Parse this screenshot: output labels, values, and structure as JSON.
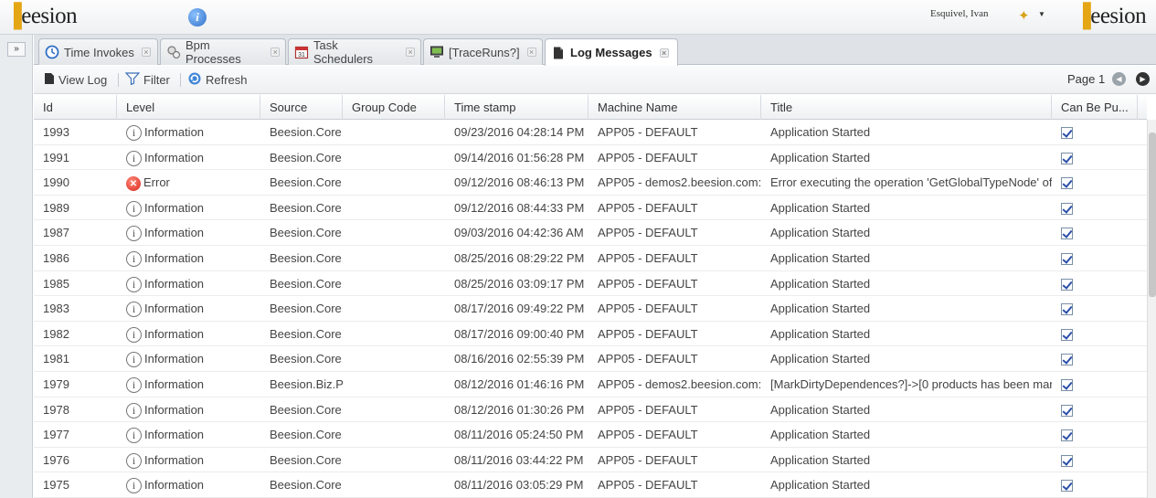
{
  "header": {
    "logo_left": "eesion",
    "logo_right": "eesion",
    "user_name": "Esquivel, Ivan",
    "info_icon_glyph": "i"
  },
  "leftstrip": {
    "expand_glyph": "»"
  },
  "tabs": [
    {
      "label": "Time Invokes",
      "icon": "clock-icon",
      "active": false
    },
    {
      "label": "Bpm Processes",
      "icon": "gears-icon",
      "active": false
    },
    {
      "label": "Task Schedulers",
      "icon": "calendar-icon",
      "active": false
    },
    {
      "label": "[TraceRuns?]",
      "icon": "monitor-icon",
      "active": false
    },
    {
      "label": "Log Messages",
      "icon": "document-icon",
      "active": true
    }
  ],
  "toolbar": {
    "view_log": "View Log",
    "filter": "Filter",
    "refresh": "Refresh",
    "page_label": "Page 1"
  },
  "grid": {
    "columns": [
      "Id",
      "Level",
      "Source",
      "Group Code",
      "Time stamp",
      "Machine Name",
      "Title",
      "Can Be Pu..."
    ],
    "rows": [
      {
        "id": "1993",
        "level": "Information",
        "source": "Beesion.Core.",
        "group": "",
        "time": "09/23/2016 04:28:14 PM",
        "machine": "APP05 - DEFAULT",
        "title": "Application Started",
        "can_be": true
      },
      {
        "id": "1991",
        "level": "Information",
        "source": "Beesion.Core.",
        "group": "",
        "time": "09/14/2016 01:56:28 PM",
        "machine": "APP05 - DEFAULT",
        "title": "Application Started",
        "can_be": true
      },
      {
        "id": "1990",
        "level": "Error",
        "source": "Beesion.Core.",
        "group": "",
        "time": "09/12/2016 08:46:13 PM",
        "machine": "APP05 - demos2.beesion.com:",
        "title": "Error executing the operation 'GetGlobalTypeNode' of",
        "can_be": true
      },
      {
        "id": "1989",
        "level": "Information",
        "source": "Beesion.Core.",
        "group": "",
        "time": "09/12/2016 08:44:33 PM",
        "machine": "APP05 - DEFAULT",
        "title": "Application Started",
        "can_be": true
      },
      {
        "id": "1987",
        "level": "Information",
        "source": "Beesion.Core.",
        "group": "",
        "time": "09/03/2016 04:42:36 AM",
        "machine": "APP05 - DEFAULT",
        "title": "Application Started",
        "can_be": true
      },
      {
        "id": "1986",
        "level": "Information",
        "source": "Beesion.Core.",
        "group": "",
        "time": "08/25/2016 08:29:22 PM",
        "machine": "APP05 - DEFAULT",
        "title": "Application Started",
        "can_be": true
      },
      {
        "id": "1985",
        "level": "Information",
        "source": "Beesion.Core.",
        "group": "",
        "time": "08/25/2016 03:09:17 PM",
        "machine": "APP05 - DEFAULT",
        "title": "Application Started",
        "can_be": true
      },
      {
        "id": "1983",
        "level": "Information",
        "source": "Beesion.Core.",
        "group": "",
        "time": "08/17/2016 09:49:22 PM",
        "machine": "APP05 - DEFAULT",
        "title": "Application Started",
        "can_be": true
      },
      {
        "id": "1982",
        "level": "Information",
        "source": "Beesion.Core.",
        "group": "",
        "time": "08/17/2016 09:00:40 PM",
        "machine": "APP05 - DEFAULT",
        "title": "Application Started",
        "can_be": true
      },
      {
        "id": "1981",
        "level": "Information",
        "source": "Beesion.Core.",
        "group": "",
        "time": "08/16/2016 02:55:39 PM",
        "machine": "APP05 - DEFAULT",
        "title": "Application Started",
        "can_be": true
      },
      {
        "id": "1979",
        "level": "Information",
        "source": "Beesion.Biz.P",
        "group": "",
        "time": "08/12/2016 01:46:16 PM",
        "machine": "APP05 - demos2.beesion.com:",
        "title": "[MarkDirtyDependences?]->[0 products has been mar",
        "can_be": true
      },
      {
        "id": "1978",
        "level": "Information",
        "source": "Beesion.Core.",
        "group": "",
        "time": "08/12/2016 01:30:26 PM",
        "machine": "APP05 - DEFAULT",
        "title": "Application Started",
        "can_be": true
      },
      {
        "id": "1977",
        "level": "Information",
        "source": "Beesion.Core.",
        "group": "",
        "time": "08/11/2016 05:24:50 PM",
        "machine": "APP05 - DEFAULT",
        "title": "Application Started",
        "can_be": true
      },
      {
        "id": "1976",
        "level": "Information",
        "source": "Beesion.Core.",
        "group": "",
        "time": "08/11/2016 03:44:22 PM",
        "machine": "APP05 - DEFAULT",
        "title": "Application Started",
        "can_be": true
      },
      {
        "id": "1975",
        "level": "Information",
        "source": "Beesion.Core.",
        "group": "",
        "time": "08/11/2016 03:05:29 PM",
        "machine": "APP05 - DEFAULT",
        "title": "Application Started",
        "can_be": true
      }
    ]
  },
  "colors": {
    "brand_gold": "#e5a613",
    "accent_blue": "#2f6fc6",
    "error_red": "#d8261b"
  }
}
